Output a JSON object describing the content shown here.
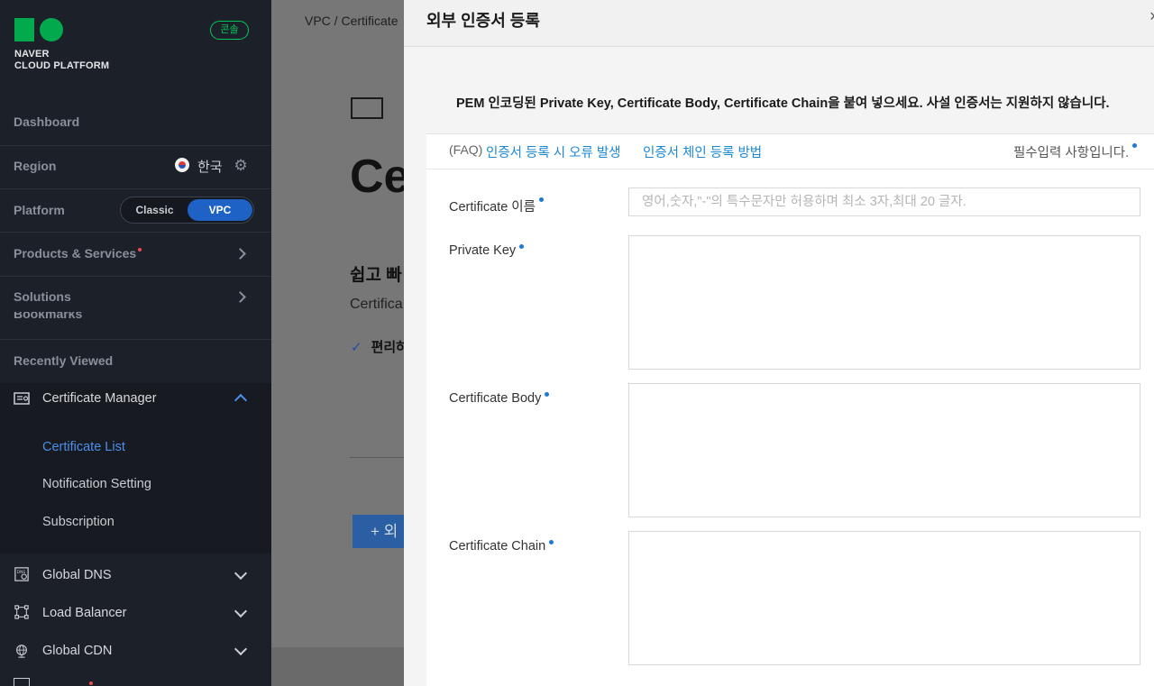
{
  "sidebar": {
    "logo_line1": "NAVER",
    "logo_line2": "CLOUD PLATFORM",
    "console_badge": "콘솔",
    "dashboard": "Dashboard",
    "region_label": "Region",
    "region_value": "한국",
    "platform_label": "Platform",
    "platform_classic": "Classic",
    "platform_vpc": "VPC",
    "products": "Products & Services",
    "solutions": "Solutions",
    "bookmarks_peek": "Bookmarks",
    "recently_viewed": "Recently Viewed",
    "certificate_manager": "Certificate Manager",
    "sub_items": [
      "Certificate List",
      "Notification Setting",
      "Subscription"
    ],
    "global_dns": "Global DNS",
    "load_balancer": "Load Balancer",
    "global_cdn": "Global CDN",
    "accent_color": "#4c8fea"
  },
  "background": {
    "breadcrumb": "VPC /  Certificate",
    "title": "Ce",
    "subtitle": "쉽고 빠",
    "desc": "Certifica",
    "check_item": "편리하",
    "button": "+ 외"
  },
  "modal": {
    "title": "외부 인증서 등록",
    "close": "×",
    "notice": "PEM 인코딩된 Private Key, Certificate Body, Certificate Chain을 붙여 넣으세요. 사설 인증서는 지원하지 않습니다.",
    "faq_prefix": "(FAQ)",
    "faq_link1": "인증서 등록 시 오류 발생",
    "faq_link2": "인증서 체인 등록 방법",
    "required_note": "필수입력 사항입니다.",
    "fields": {
      "name_label": "Certificate 이름",
      "name_placeholder": "영어,숫자,\"-\"의 특수문자만 허용하며 최소 3자,최대 20 글자.",
      "private_key_label": "Private Key",
      "body_label": "Certificate Body",
      "chain_label": "Certificate Chain"
    },
    "link_color": "#1b88d4"
  }
}
